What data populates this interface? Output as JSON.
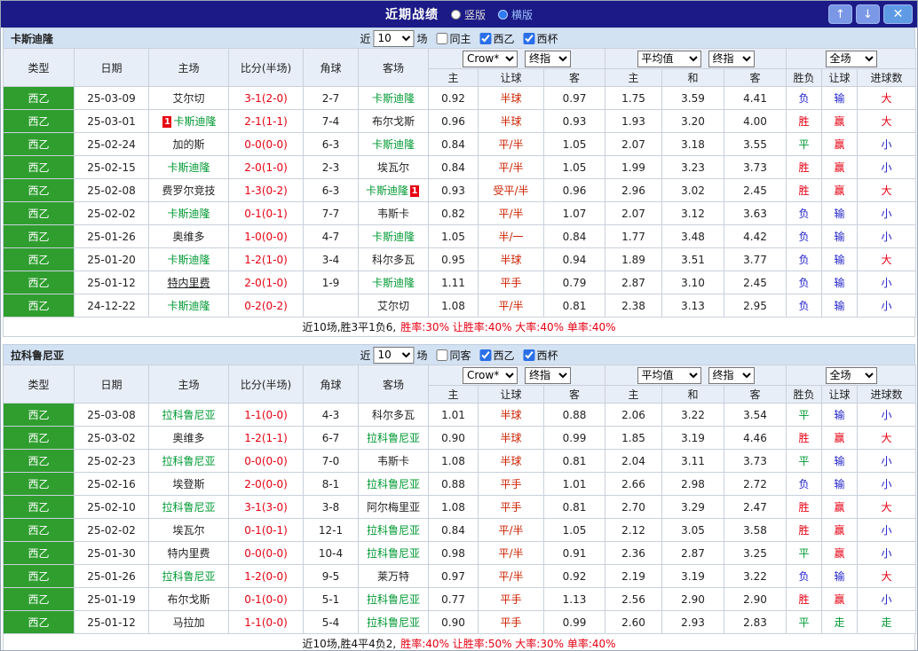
{
  "titlebar": {
    "title": "近期战绩",
    "radio_vertical": "竖版",
    "radio_horizontal": "横版",
    "up_icon": "↑",
    "down_icon": "↓",
    "close_icon": "✕"
  },
  "controls": {
    "near": "近",
    "count": "10",
    "games": "场",
    "league": "西乙",
    "cup": "西杯"
  },
  "headers": {
    "type": "类型",
    "date": "日期",
    "home": "主场",
    "score": "比分(半场)",
    "corner": "角球",
    "away": "客场",
    "odds_company": "Crow*",
    "odds_kind": "终指",
    "avg": "平均值",
    "avg_kind": "终指",
    "full": "全场",
    "h": "主",
    "hcp": "让球",
    "a": "客",
    "avg_h": "主",
    "avg_d": "和",
    "avg_a": "客",
    "wdl": "胜负",
    "hcp_r": "让球",
    "goals": "进球数"
  },
  "colors": {
    "titlebar_navy": "#1b1a86",
    "type_green": "#2f9e2f",
    "focus_team_green": "#009933",
    "win_red": "#e60012",
    "lose_blue": "#2323cc",
    "draw_green": "#009933"
  },
  "sections": [
    {
      "team": "卡斯迪隆",
      "same_label": "同主",
      "rows": [
        {
          "league": "西乙",
          "date": "25-03-09",
          "home": "艾尔切",
          "home_hl": false,
          "away": "卡斯迪隆",
          "away_hl": true,
          "score": "3-1(2-0)",
          "corner": "2-7",
          "odds_h": "0.92",
          "handicap": "半球",
          "odds_a": "0.97",
          "avg_h": "1.75",
          "avg_d": "3.59",
          "avg_a": "4.41",
          "result": "负",
          "hcp_result": "输",
          "goals_result": "大"
        },
        {
          "league": "西乙",
          "date": "25-03-01",
          "home": "卡斯迪隆",
          "home_hl": true,
          "home_card": "1",
          "away": "布尔戈斯",
          "away_hl": false,
          "score": "2-1(1-1)",
          "corner": "7-4",
          "odds_h": "0.96",
          "handicap": "半球",
          "odds_a": "0.93",
          "avg_h": "1.93",
          "avg_d": "3.20",
          "avg_a": "4.00",
          "result": "胜",
          "hcp_result": "赢",
          "goals_result": "大"
        },
        {
          "league": "西乙",
          "date": "25-02-24",
          "home": "加的斯",
          "home_hl": false,
          "away": "卡斯迪隆",
          "away_hl": true,
          "score": "0-0(0-0)",
          "corner": "6-3",
          "odds_h": "0.84",
          "handicap": "平/半",
          "odds_a": "1.05",
          "avg_h": "2.07",
          "avg_d": "3.18",
          "avg_a": "3.55",
          "result": "平",
          "hcp_result": "赢",
          "goals_result": "小"
        },
        {
          "league": "西乙",
          "date": "25-02-15",
          "home": "卡斯迪隆",
          "home_hl": true,
          "away": "埃瓦尔",
          "away_hl": false,
          "score": "2-0(1-0)",
          "corner": "2-3",
          "odds_h": "0.84",
          "handicap": "平/半",
          "odds_a": "1.05",
          "avg_h": "1.99",
          "avg_d": "3.23",
          "avg_a": "3.73",
          "result": "胜",
          "hcp_result": "赢",
          "goals_result": "小"
        },
        {
          "league": "西乙",
          "date": "25-02-08",
          "home": "费罗尔竞技",
          "home_hl": false,
          "away": "卡斯迪隆",
          "away_hl": true,
          "away_card": "1",
          "score": "1-3(0-2)",
          "corner": "6-3",
          "odds_h": "0.93",
          "handicap": "受平/半",
          "odds_a": "0.96",
          "avg_h": "2.96",
          "avg_d": "3.02",
          "avg_a": "2.45",
          "result": "胜",
          "hcp_result": "赢",
          "goals_result": "大"
        },
        {
          "league": "西乙",
          "date": "25-02-02",
          "home": "卡斯迪隆",
          "home_hl": true,
          "away": "韦斯卡",
          "away_hl": false,
          "score": "0-1(0-1)",
          "corner": "7-7",
          "odds_h": "0.82",
          "handicap": "平/半",
          "odds_a": "1.07",
          "avg_h": "2.07",
          "avg_d": "3.12",
          "avg_a": "3.63",
          "result": "负",
          "hcp_result": "输",
          "goals_result": "小"
        },
        {
          "league": "西乙",
          "date": "25-01-26",
          "home": "奥维多",
          "home_hl": false,
          "away": "卡斯迪隆",
          "away_hl": true,
          "score": "1-0(0-0)",
          "corner": "4-7",
          "odds_h": "1.05",
          "handicap": "半/一",
          "odds_a": "0.84",
          "avg_h": "1.77",
          "avg_d": "3.48",
          "avg_a": "4.42",
          "result": "负",
          "hcp_result": "输",
          "goals_result": "小"
        },
        {
          "league": "西乙",
          "date": "25-01-20",
          "home": "卡斯迪隆",
          "home_hl": true,
          "away": "科尔多瓦",
          "away_hl": false,
          "score": "1-2(1-0)",
          "corner": "3-4",
          "odds_h": "0.95",
          "handicap": "半球",
          "odds_a": "0.94",
          "avg_h": "1.89",
          "avg_d": "3.51",
          "avg_a": "3.77",
          "result": "负",
          "hcp_result": "输",
          "goals_result": "大"
        },
        {
          "league": "西乙",
          "date": "25-01-12",
          "home": "特内里费",
          "home_hl": false,
          "home_underline": true,
          "away": "卡斯迪隆",
          "away_hl": true,
          "score": "2-0(1-0)",
          "corner": "1-9",
          "odds_h": "1.11",
          "handicap": "平手",
          "odds_a": "0.79",
          "avg_h": "2.87",
          "avg_d": "3.10",
          "avg_a": "2.45",
          "result": "负",
          "hcp_result": "输",
          "goals_result": "小"
        },
        {
          "league": "西乙",
          "date": "24-12-22",
          "home": "卡斯迪隆",
          "home_hl": true,
          "away": "艾尔切",
          "away_hl": false,
          "score": "0-2(0-2)",
          "corner": "",
          "odds_h": "1.08",
          "handicap": "平/半",
          "odds_a": "0.81",
          "avg_h": "2.38",
          "avg_d": "3.13",
          "avg_a": "2.95",
          "result": "负",
          "hcp_result": "输",
          "goals_result": "小"
        }
      ],
      "summary": {
        "record": "近10场,胜3平1负6,",
        "stats": "胜率:30% 让胜率:40% 大率:40% 单率:40%"
      }
    },
    {
      "team": "拉科鲁尼亚",
      "same_label": "同客",
      "rows": [
        {
          "league": "西乙",
          "date": "25-03-08",
          "home": "拉科鲁尼亚",
          "home_hl": true,
          "away": "科尔多瓦",
          "away_hl": false,
          "score": "1-1(0-0)",
          "corner": "4-3",
          "odds_h": "1.01",
          "handicap": "半球",
          "odds_a": "0.88",
          "avg_h": "2.06",
          "avg_d": "3.22",
          "avg_a": "3.54",
          "result": "平",
          "hcp_result": "输",
          "goals_result": "小"
        },
        {
          "league": "西乙",
          "date": "25-03-02",
          "home": "奥维多",
          "home_hl": false,
          "away": "拉科鲁尼亚",
          "away_hl": true,
          "score": "1-2(1-1)",
          "corner": "6-7",
          "odds_h": "0.90",
          "handicap": "半球",
          "odds_a": "0.99",
          "avg_h": "1.85",
          "avg_d": "3.19",
          "avg_a": "4.46",
          "result": "胜",
          "hcp_result": "赢",
          "goals_result": "大"
        },
        {
          "league": "西乙",
          "date": "25-02-23",
          "home": "拉科鲁尼亚",
          "home_hl": true,
          "away": "韦斯卡",
          "away_hl": false,
          "score": "0-0(0-0)",
          "corner": "7-0",
          "odds_h": "1.08",
          "handicap": "半球",
          "odds_a": "0.81",
          "avg_h": "2.04",
          "avg_d": "3.11",
          "avg_a": "3.73",
          "result": "平",
          "hcp_result": "输",
          "goals_result": "小"
        },
        {
          "league": "西乙",
          "date": "25-02-16",
          "home": "埃登斯",
          "home_hl": false,
          "away": "拉科鲁尼亚",
          "away_hl": true,
          "score": "2-0(0-0)",
          "corner": "8-1",
          "odds_h": "0.88",
          "handicap": "平手",
          "odds_a": "1.01",
          "avg_h": "2.66",
          "avg_d": "2.98",
          "avg_a": "2.72",
          "result": "负",
          "hcp_result": "输",
          "goals_result": "小"
        },
        {
          "league": "西乙",
          "date": "25-02-10",
          "home": "拉科鲁尼亚",
          "home_hl": true,
          "away": "阿尔梅里亚",
          "away_hl": false,
          "score": "3-1(3-0)",
          "corner": "3-8",
          "odds_h": "1.08",
          "handicap": "平手",
          "odds_a": "0.81",
          "avg_h": "2.70",
          "avg_d": "3.29",
          "avg_a": "2.47",
          "result": "胜",
          "hcp_result": "赢",
          "goals_result": "大"
        },
        {
          "league": "西乙",
          "date": "25-02-02",
          "home": "埃瓦尔",
          "home_hl": false,
          "away": "拉科鲁尼亚",
          "away_hl": true,
          "score": "0-1(0-1)",
          "corner": "12-1",
          "odds_h": "0.84",
          "handicap": "平/半",
          "odds_a": "1.05",
          "avg_h": "2.12",
          "avg_d": "3.05",
          "avg_a": "3.58",
          "result": "胜",
          "hcp_result": "赢",
          "goals_result": "小"
        },
        {
          "league": "西乙",
          "date": "25-01-30",
          "home": "特内里费",
          "home_hl": false,
          "away": "拉科鲁尼亚",
          "away_hl": true,
          "score": "0-0(0-0)",
          "corner": "10-4",
          "odds_h": "0.98",
          "handicap": "平/半",
          "odds_a": "0.91",
          "avg_h": "2.36",
          "avg_d": "2.87",
          "avg_a": "3.25",
          "result": "平",
          "hcp_result": "赢",
          "goals_result": "小"
        },
        {
          "league": "西乙",
          "date": "25-01-26",
          "home": "拉科鲁尼亚",
          "home_hl": true,
          "away": "莱万特",
          "away_hl": false,
          "score": "1-2(0-0)",
          "corner": "9-5",
          "odds_h": "0.97",
          "handicap": "平/半",
          "odds_a": "0.92",
          "avg_h": "2.19",
          "avg_d": "3.19",
          "avg_a": "3.22",
          "result": "负",
          "hcp_result": "输",
          "goals_result": "大"
        },
        {
          "league": "西乙",
          "date": "25-01-19",
          "home": "布尔戈斯",
          "home_hl": false,
          "away": "拉科鲁尼亚",
          "away_hl": true,
          "score": "0-1(0-0)",
          "corner": "5-1",
          "odds_h": "0.77",
          "handicap": "平手",
          "odds_a": "1.13",
          "avg_h": "2.56",
          "avg_d": "2.90",
          "avg_a": "2.90",
          "result": "胜",
          "hcp_result": "赢",
          "goals_result": "小"
        },
        {
          "league": "西乙",
          "date": "25-01-12",
          "home": "马拉加",
          "home_hl": false,
          "away": "拉科鲁尼亚",
          "away_hl": true,
          "score": "1-1(0-0)",
          "corner": "5-4",
          "odds_h": "0.90",
          "handicap": "平手",
          "odds_a": "0.99",
          "avg_h": "2.60",
          "avg_d": "2.93",
          "avg_a": "2.83",
          "result": "平",
          "hcp_result": "走",
          "goals_result": "走"
        }
      ],
      "summary": {
        "record": "近10场,胜4平4负2,",
        "stats": "胜率:40% 让胜率:50% 大率:30% 单率:40%"
      }
    }
  ]
}
